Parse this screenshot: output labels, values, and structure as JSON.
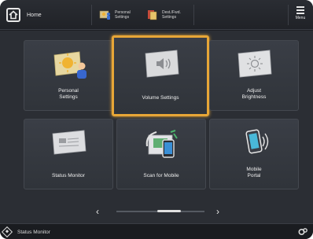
{
  "header": {
    "home_label": "Home",
    "shortcuts": [
      {
        "label": "Personal\nSettings",
        "icon": "personal-settings-icon"
      },
      {
        "label": "Dest./Fwd.\nSettings",
        "icon": "destination-forward-settings-icon"
      }
    ],
    "menu_label": "Menu"
  },
  "tiles": [
    {
      "label": "Personal\nSettings",
      "icon": "personal-settings-icon",
      "selected": false
    },
    {
      "label": "Volume Settings",
      "icon": "volume-settings-icon",
      "selected": true
    },
    {
      "label": "Adjust\nBrightness",
      "icon": "brightness-icon",
      "selected": false
    },
    {
      "label": "Status Monitor",
      "icon": "status-monitor-icon",
      "selected": false
    },
    {
      "label": "Scan for Mobile",
      "icon": "scan-for-mobile-icon",
      "selected": false
    },
    {
      "label": "Mobile\nPortal",
      "icon": "mobile-portal-icon",
      "selected": false
    }
  ],
  "pager": {
    "prev": "‹",
    "next": "›"
  },
  "statusbar": {
    "status_monitor_label": "Status Monitor"
  },
  "colors": {
    "selection": "#e7a637",
    "background": "#2b2e34"
  }
}
